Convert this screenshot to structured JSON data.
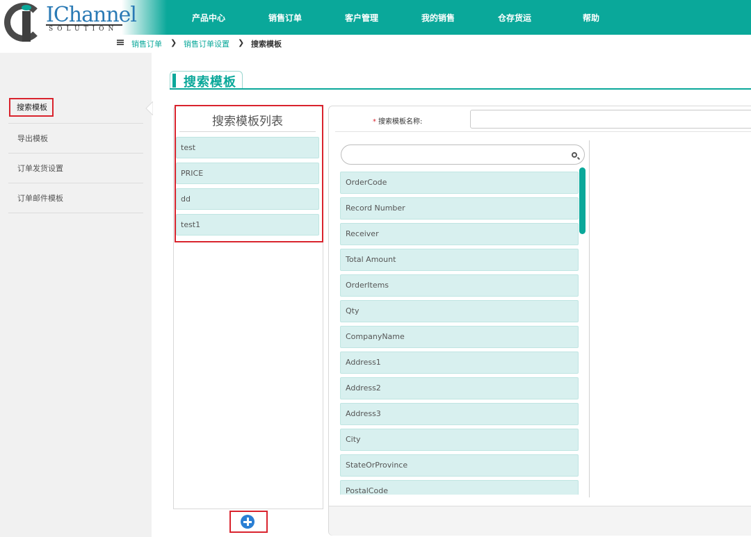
{
  "header": {
    "logo_text": "IChannel",
    "logo_sub": "SOLUTION",
    "nav": [
      "产品中心",
      "销售订单",
      "客户管理",
      "我的销售",
      "仓存货运",
      "帮助"
    ]
  },
  "breadcrumb": {
    "items": [
      "销售订单",
      "销售订单设置"
    ],
    "separator": "❯",
    "current": "搜索模板"
  },
  "sidebar": {
    "active": "搜索模板",
    "items": [
      "导出模板",
      "订单发货设置",
      "订单邮件模板"
    ]
  },
  "page": {
    "title": "搜索模板"
  },
  "template_list": {
    "title": "搜索模板列表",
    "items": [
      "test",
      "PRICE",
      "dd",
      "test1"
    ],
    "add_icon": "plus-circle-icon"
  },
  "form": {
    "required_mark": "*",
    "name_label": "搜索模板名称:",
    "name_value": "",
    "search_value": "",
    "fields": [
      "OrderCode",
      "Record Number",
      "Receiver",
      "Total Amount",
      "OrderItems",
      "Qty",
      "CompanyName",
      "Address1",
      "Address2",
      "Address3",
      "City",
      "StateOrProvince",
      "PostalCode"
    ]
  },
  "colors": {
    "accent": "#0aa89a",
    "item_bg": "#d8f0ef",
    "highlight": "#d9232d",
    "add_button": "#2a7fd4"
  }
}
